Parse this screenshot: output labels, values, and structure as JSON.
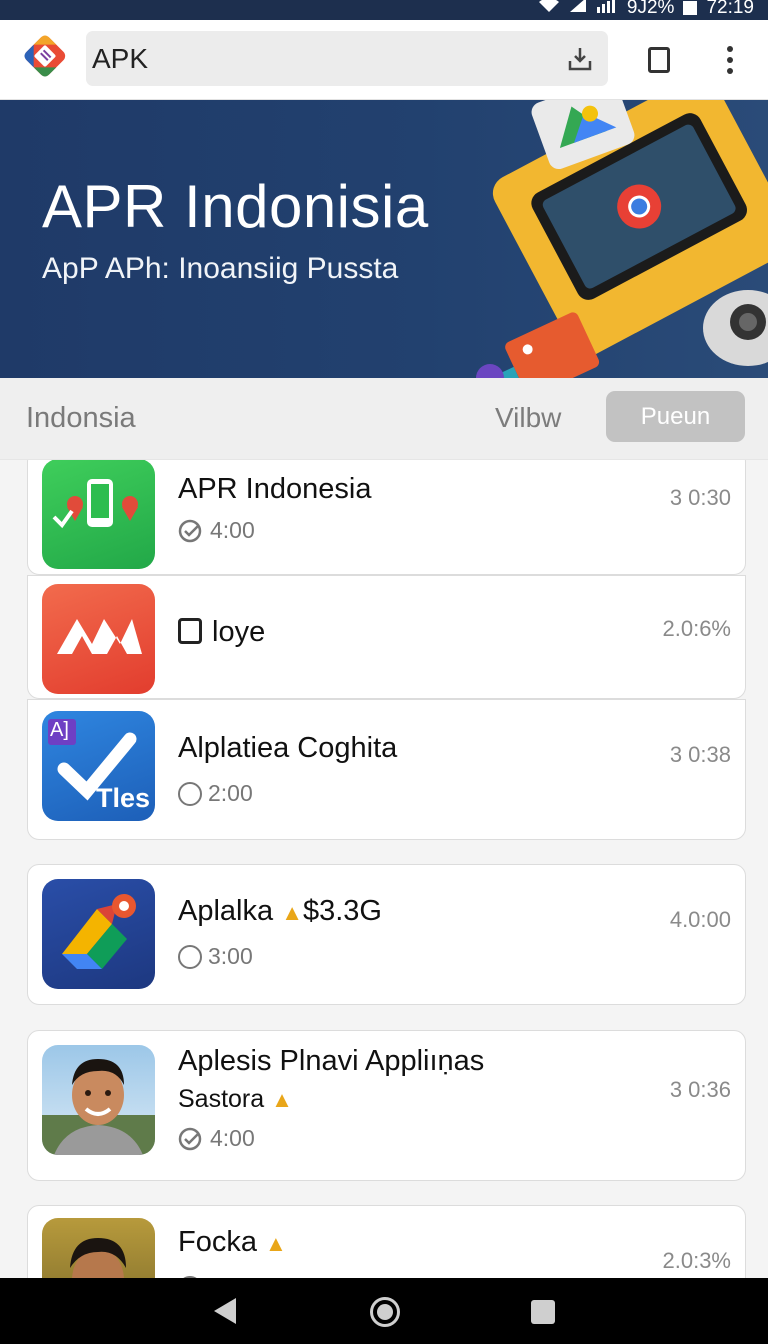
{
  "status_bar": {
    "battery_text": "9J2%",
    "time": "72:19"
  },
  "toolbar": {
    "url_text": "APK"
  },
  "hero": {
    "title": "APR Indonisia",
    "subtitle": "ApP APh: Inoansiig Pussta"
  },
  "filter": {
    "input_value": "Indonsia",
    "view_label": "Vilbw",
    "button_label": "Pueun"
  },
  "apps": [
    {
      "name": "APR Indonesia",
      "meta": "4:00",
      "time": "3 0:30",
      "icon_text": ""
    },
    {
      "name": "loye",
      "meta": "",
      "time": "2.0:6%",
      "icon_text": ""
    },
    {
      "name": "Alplatiea Coghita",
      "meta": "2:00",
      "time": "3 0:38",
      "icon_text": "Tles",
      "icon_small": "A]"
    },
    {
      "name": "Aplalka",
      "badge": "$3.3G",
      "meta": "3:00",
      "time": "4.0:00",
      "icon_text": ""
    },
    {
      "name": "Aplesis Plnavi Appliıṇas",
      "sub": "Sastora",
      "meta": "4:00",
      "time": "3 0:36",
      "icon_text": ""
    },
    {
      "name": "Focka",
      "meta": "",
      "time": "2.0:3%",
      "icon_text": ""
    }
  ],
  "colors": {
    "hero_bg": "#1f3a68",
    "filter_button": "#c2c2c2",
    "status_bar": "#1d2f4e"
  }
}
